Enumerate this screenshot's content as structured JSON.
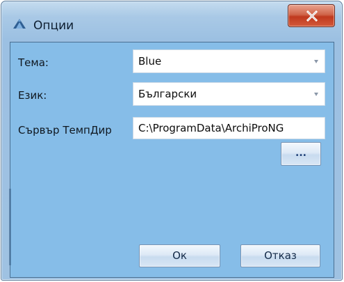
{
  "window": {
    "title": "Опции",
    "title_icon": "archipro-logo-triangle-icon",
    "close_icon": "close-x-icon"
  },
  "form": {
    "theme": {
      "label": "Тема:",
      "value": "Blue"
    },
    "language": {
      "label": "Език:",
      "value": "Български"
    },
    "server_temp_dir": {
      "label": "Сървър ТемпДир",
      "value": "C:\\ProgramData\\ArchiProNG"
    },
    "browse_label": "..."
  },
  "buttons": {
    "ok": "Ок",
    "cancel": "Отказ"
  },
  "colors": {
    "client_background": "#86bde8",
    "close_button": "#c9472a",
    "logo_accent": "#2f5f93"
  }
}
